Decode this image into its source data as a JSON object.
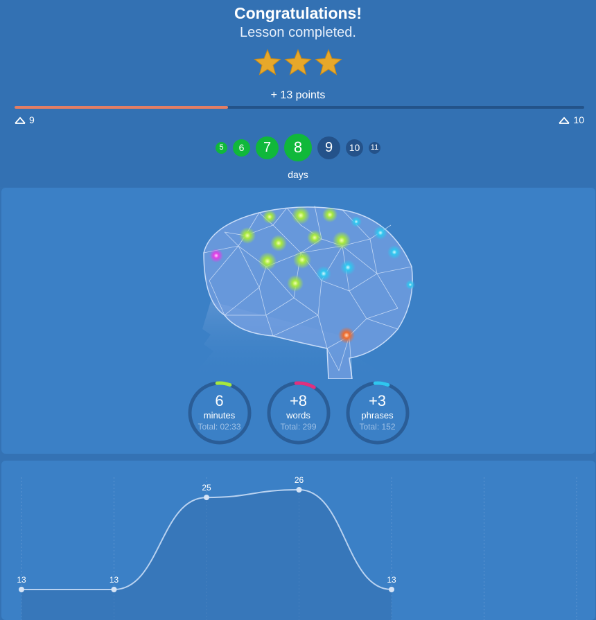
{
  "header": {
    "title": "Congratulations!",
    "subtitle": "Lesson completed.",
    "stars": 3,
    "points_label": "+ 13 points",
    "level_progress": 0.375,
    "level_current": "9",
    "level_next": "10"
  },
  "streak": {
    "days": [
      {
        "label": "5",
        "done": true
      },
      {
        "label": "6",
        "done": true
      },
      {
        "label": "7",
        "done": true
      },
      {
        "label": "8",
        "done": true,
        "current": true
      },
      {
        "label": "9",
        "done": false
      },
      {
        "label": "10",
        "done": false
      },
      {
        "label": "11",
        "done": false
      }
    ],
    "label": "days"
  },
  "stats": [
    {
      "value": "6",
      "unit": "minutes",
      "total": "Total: 02:33",
      "color": "#a6e83e",
      "fraction": 0.07
    },
    {
      "value": "+8",
      "unit": "words",
      "total": "Total: 299",
      "color": "#e0307e",
      "fraction": 0.1
    },
    {
      "value": "+3",
      "unit": "phrases",
      "total": "Total: 152",
      "color": "#2fc6ef",
      "fraction": 0.07
    }
  ],
  "chart_data": {
    "type": "line",
    "x": [
      1,
      2,
      3,
      4,
      5
    ],
    "values": [
      13,
      13,
      25,
      26,
      13
    ],
    "data_labels": [
      "13",
      "13",
      "25",
      "26",
      "13"
    ],
    "title": "",
    "xlabel": "",
    "ylabel": "",
    "grid": true
  }
}
